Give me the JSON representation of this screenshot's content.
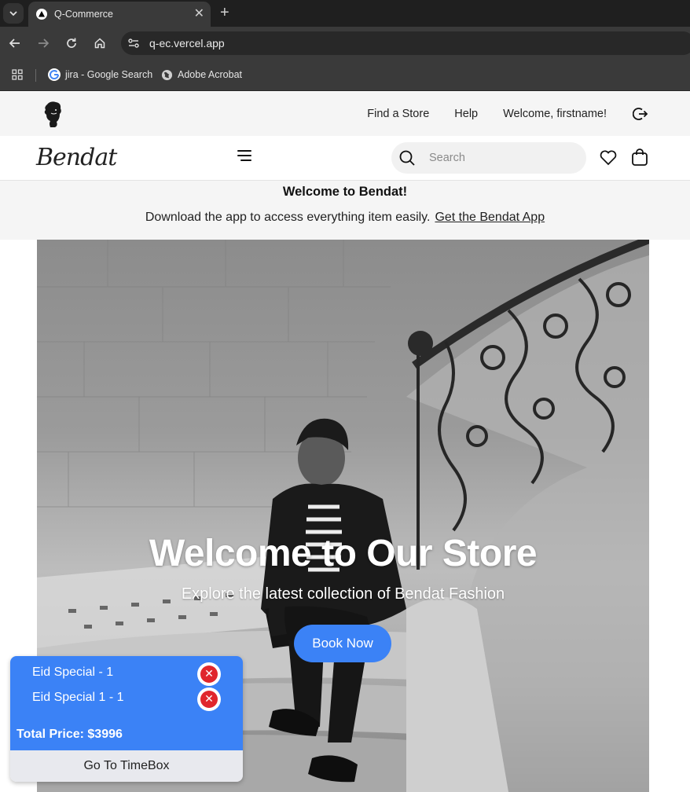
{
  "browser": {
    "tab_title": "Q-Commerce",
    "url": "q-ec.vercel.app",
    "bookmarks": [
      {
        "label": "jira - Google Search"
      },
      {
        "label": "Adobe Acrobat"
      }
    ]
  },
  "topbar": {
    "find_store": "Find a Store",
    "help": "Help",
    "welcome": "Welcome, firstname!"
  },
  "nav": {
    "logo": "Bendat",
    "search_placeholder": "Search"
  },
  "promo": {
    "title": "Welcome to Bendat!",
    "text": "Download the app to access everything item easily.",
    "link": "Get the Bendat App"
  },
  "hero": {
    "title": "Welcome to Our Store",
    "subtitle": "Explore the latest collection of Bendat Fashion",
    "button": "Book Now"
  },
  "cart": {
    "items": [
      {
        "label": "Eid Special - 1"
      },
      {
        "label": "Eid Special 1 - 1"
      }
    ],
    "total": "Total Price: $3996",
    "action": "Go To TimeBox"
  },
  "colors": {
    "accent": "#3b82f6",
    "remove": "#e0262d",
    "browser_dark": "#1f1f1f"
  }
}
